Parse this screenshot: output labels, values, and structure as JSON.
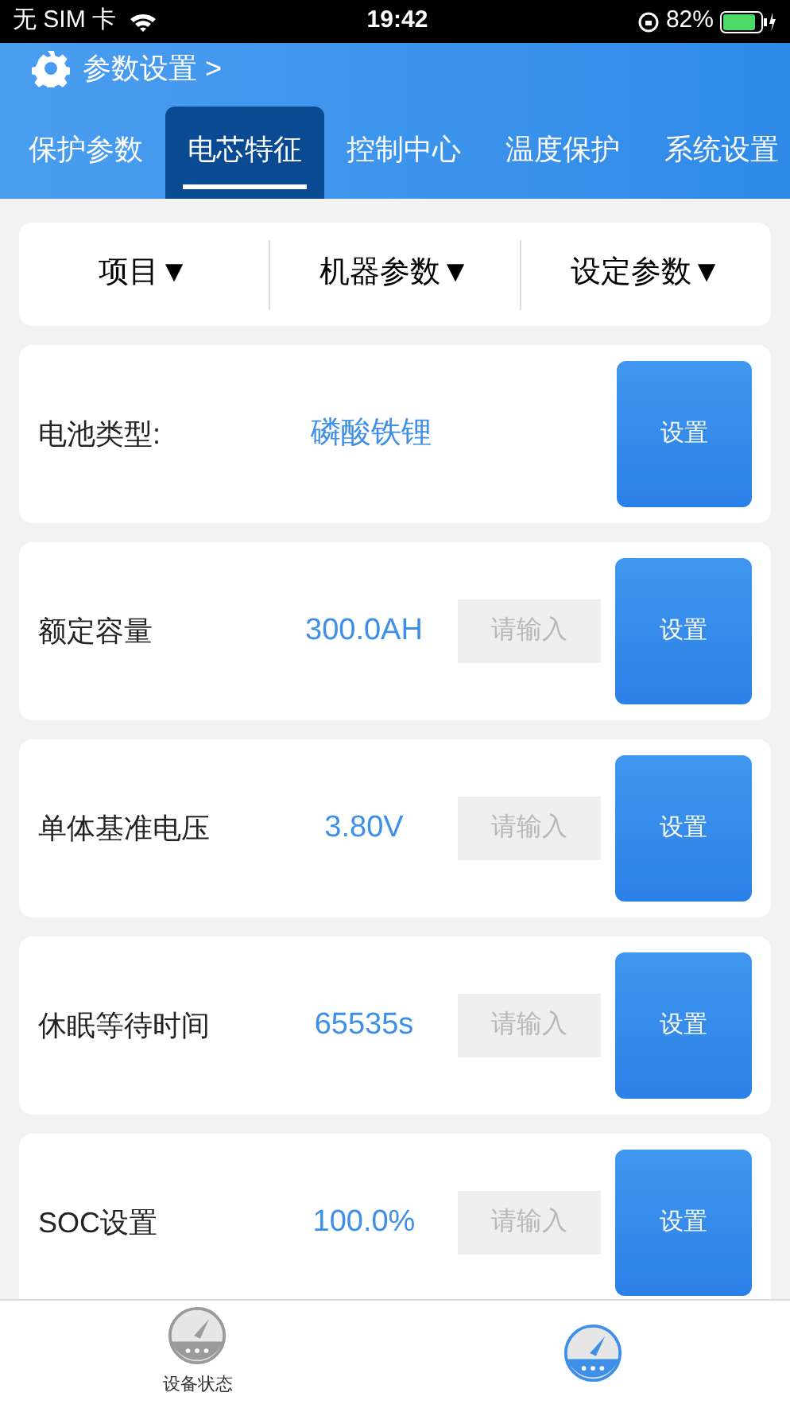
{
  "status_bar": {
    "carrier": "无 SIM 卡",
    "time": "19:42",
    "battery": "82%"
  },
  "breadcrumb": "参数设置 >",
  "tabs": [
    {
      "label": "保护参数",
      "selected": false
    },
    {
      "label": "电芯特征",
      "selected": true
    },
    {
      "label": "控制中心",
      "selected": false
    },
    {
      "label": "温度保护",
      "selected": false
    },
    {
      "label": "系统设置",
      "selected": false
    }
  ],
  "columns": [
    "项目▼",
    "机器参数▼",
    "设定参数▼"
  ],
  "rows": [
    {
      "kind": "display",
      "label": "电池类型:",
      "value": "磷酸铁锂",
      "button": "设置"
    },
    {
      "kind": "input",
      "label": "额定容量",
      "value": "300.0AH",
      "placeholder": "请输入",
      "button": "设置"
    },
    {
      "kind": "input",
      "label": "单体基准电压",
      "value": "3.80V",
      "placeholder": "请输入",
      "button": "设置"
    },
    {
      "kind": "input",
      "label": "休眠等待时间",
      "value": "65535s",
      "placeholder": "请输入",
      "button": "设置"
    },
    {
      "kind": "input",
      "label": "SOC设置",
      "value": "100.0%",
      "placeholder": "请输入",
      "button": "设置"
    }
  ],
  "bottom_nav": [
    {
      "label": "设备状态",
      "selected": false
    },
    {
      "selected": true
    }
  ]
}
